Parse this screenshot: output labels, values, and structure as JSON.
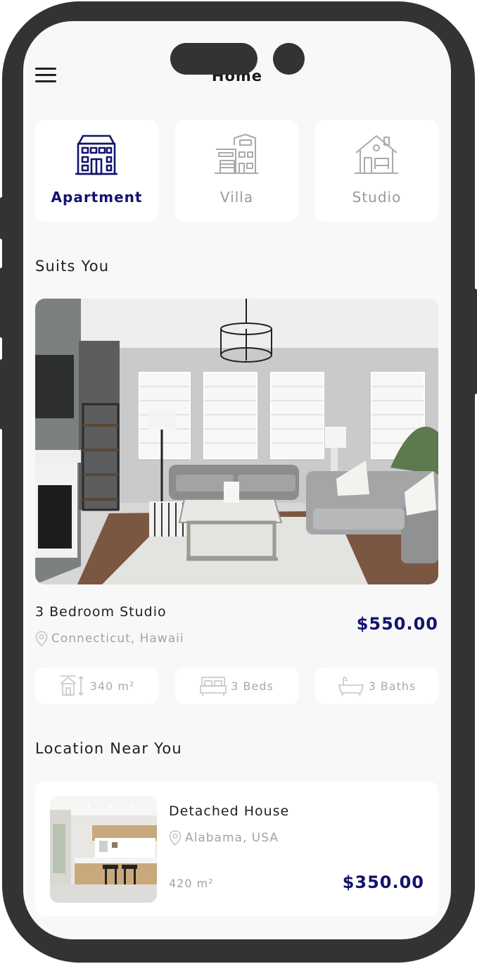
{
  "header": {
    "title": "Home"
  },
  "categories": [
    {
      "label": "Apartment",
      "icon": "apartment-icon",
      "active": true
    },
    {
      "label": "Villa",
      "icon": "villa-icon",
      "active": false
    },
    {
      "label": "Studio",
      "icon": "studio-icon",
      "active": false
    }
  ],
  "suits_you": {
    "heading": "Suits You",
    "image": "living-room-photo",
    "title": "3 Bedroom Studio",
    "location": "Connecticut, Hawaii",
    "price": "$550.00",
    "features": [
      {
        "icon": "area-icon",
        "label": "340 m²"
      },
      {
        "icon": "bed-icon",
        "label": "3 Beds"
      },
      {
        "icon": "bathtub-icon",
        "label": "3 Baths"
      }
    ]
  },
  "near_you": {
    "heading": "Location Near You",
    "items": [
      {
        "image": "kitchen-photo",
        "title": "Detached House",
        "location": "Alabama, USA",
        "area": "420 m²",
        "price": "$350.00"
      }
    ]
  },
  "colors": {
    "accent": "#13136e",
    "muted": "#a3a3a3",
    "frame": "#333333"
  }
}
